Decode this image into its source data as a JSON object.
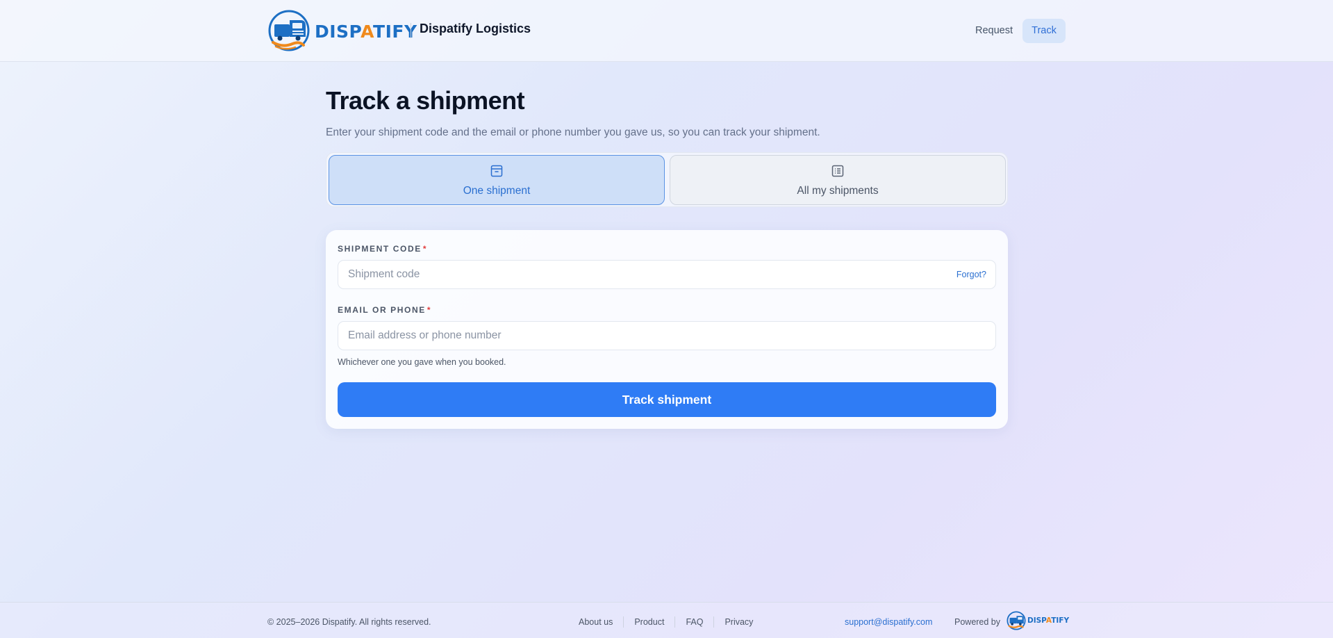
{
  "header": {
    "logo": {
      "word_blue_1": "DISP",
      "word_orange": "A",
      "word_blue_2": "TIFY"
    },
    "brand_name": "Dispatify Logistics",
    "nav": {
      "request": "Request",
      "track": "Track",
      "active": "Track"
    }
  },
  "main": {
    "title": "Track a shipment",
    "subtitle": "Enter your shipment code and the email or phone number you gave us, so you can track your shipment.",
    "tabs": [
      {
        "label": "One shipment",
        "icon": "archive-box-icon",
        "selected": true
      },
      {
        "label": "All my shipments",
        "icon": "list-document-icon",
        "selected": false
      }
    ],
    "form": {
      "shipment_code": {
        "label": "SHIPMENT CODE",
        "required_mark": "*",
        "placeholder": "Shipment code",
        "value": "",
        "link": "Forgot?"
      },
      "contact": {
        "label": "EMAIL OR PHONE",
        "required_mark": "*",
        "placeholder": "Email address or phone number",
        "value": "",
        "hint": "Whichever one you gave when you booked."
      },
      "submit_label": "Track shipment"
    }
  },
  "footer": {
    "copyright": "© 2025–2026 Dispatify. All rights reserved.",
    "links": [
      "About us",
      "Product",
      "FAQ",
      "Privacy"
    ],
    "support_email": "support@dispatify.com",
    "powered_by": "Powered by"
  },
  "colors": {
    "accent": "#2f7cf5",
    "brand_blue": "#1d6fc4",
    "brand_orange": "#f08a1c",
    "required": "#e23c3c"
  }
}
